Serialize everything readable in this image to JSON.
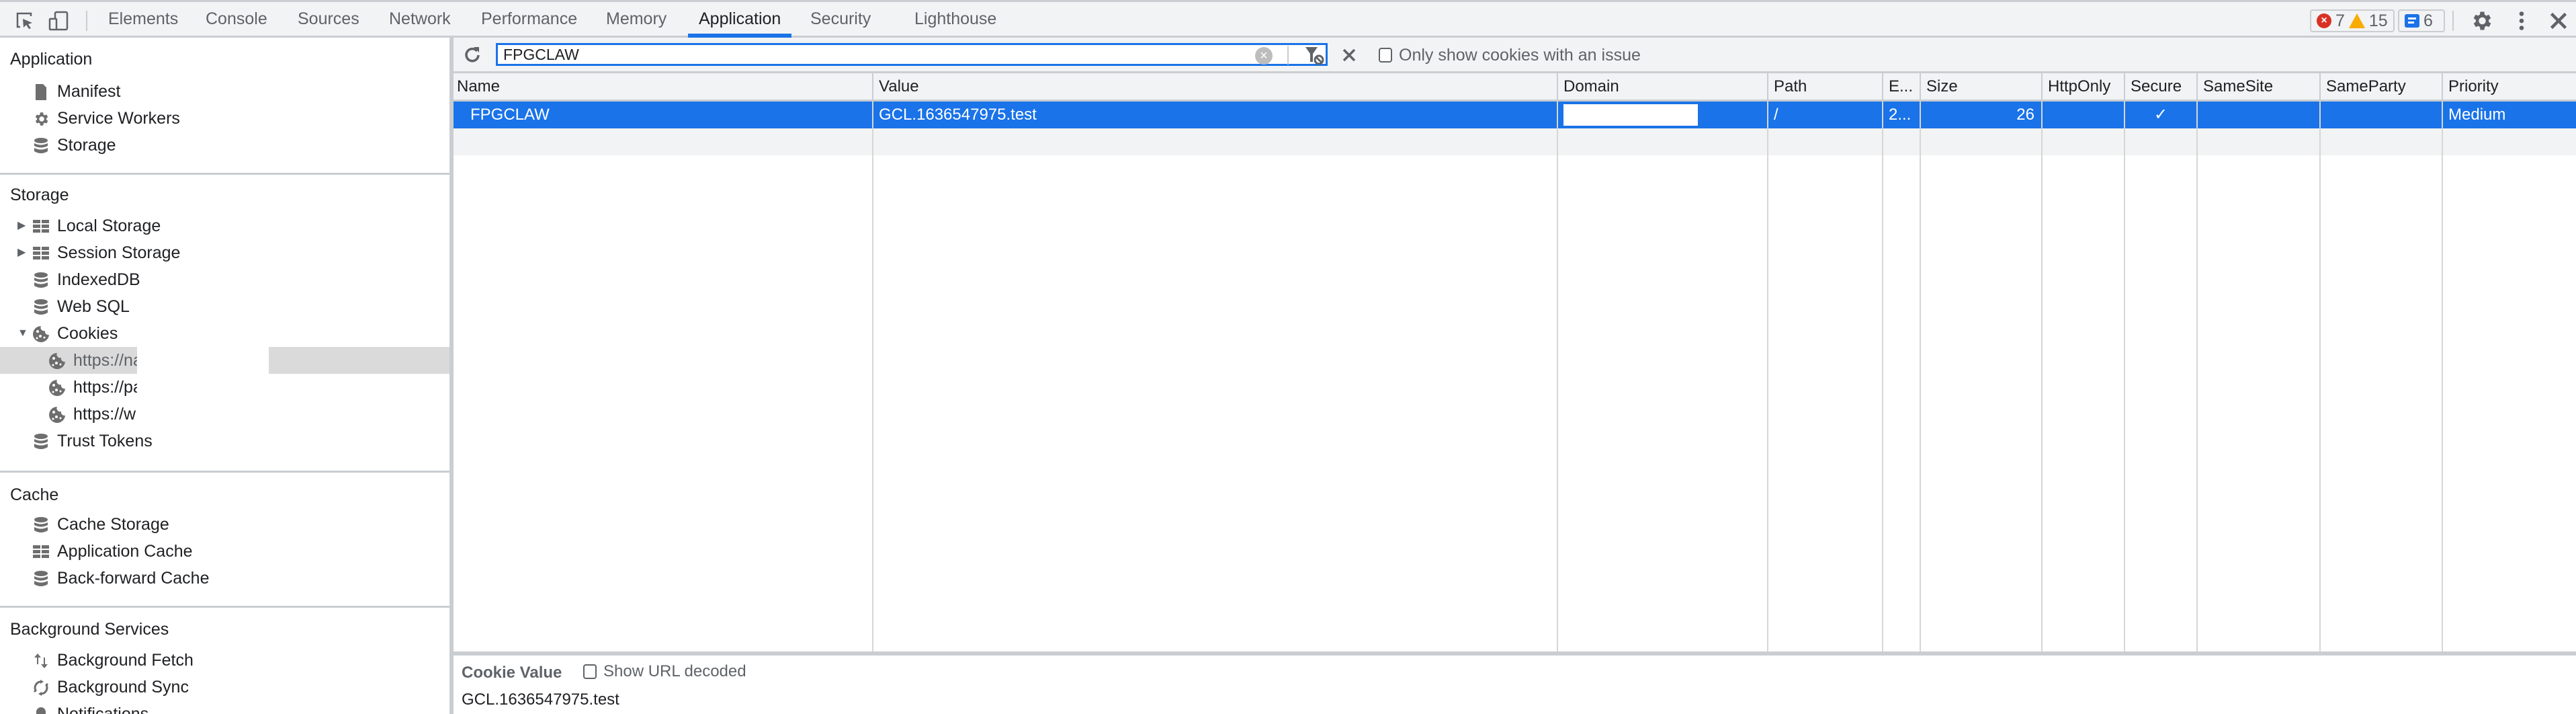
{
  "topbar": {
    "tabs": [
      {
        "label": "Elements",
        "active": false
      },
      {
        "label": "Console",
        "active": false
      },
      {
        "label": "Sources",
        "active": false
      },
      {
        "label": "Network",
        "active": false
      },
      {
        "label": "Performance",
        "active": false
      },
      {
        "label": "Memory",
        "active": false
      },
      {
        "label": "Application",
        "active": true
      },
      {
        "label": "Security",
        "active": false
      },
      {
        "label": "Lighthouse",
        "active": false
      }
    ],
    "errors_count": "7",
    "warnings_count": "15",
    "messages_count": "6",
    "accent_color": "#1a73e8"
  },
  "sidebar": {
    "sections": [
      {
        "title": "Application",
        "items": [
          {
            "label": "Manifest",
            "icon": "document-icon"
          },
          {
            "label": "Service Workers",
            "icon": "gear-icon"
          },
          {
            "label": "Storage",
            "icon": "database-icon"
          }
        ]
      },
      {
        "title": "Storage",
        "items": [
          {
            "label": "Local Storage",
            "icon": "grid-icon",
            "expandable": true,
            "expanded": false
          },
          {
            "label": "Session Storage",
            "icon": "grid-icon",
            "expandable": true,
            "expanded": false
          },
          {
            "label": "IndexedDB",
            "icon": "database-icon"
          },
          {
            "label": "Web SQL",
            "icon": "database-icon"
          },
          {
            "label": "Cookies",
            "icon": "cookie-icon",
            "expandable": true,
            "expanded": true,
            "children": [
              {
                "label": "https://na",
                "icon": "cookie-icon",
                "selected": true
              },
              {
                "label": "https://pa",
                "icon": "cookie-icon"
              },
              {
                "label": "https://w",
                "icon": "cookie-icon"
              }
            ]
          },
          {
            "label": "Trust Tokens",
            "icon": "database-icon"
          }
        ]
      },
      {
        "title": "Cache",
        "items": [
          {
            "label": "Cache Storage",
            "icon": "database-icon"
          },
          {
            "label": "Application Cache",
            "icon": "grid-icon"
          },
          {
            "label": "Back-forward Cache",
            "icon": "database-icon"
          }
        ]
      },
      {
        "title": "Background Services",
        "items": [
          {
            "label": "Background Fetch",
            "icon": "arrows-updown-icon"
          },
          {
            "label": "Background Sync",
            "icon": "sync-icon"
          },
          {
            "label": "Notifications",
            "icon": "bell-icon"
          }
        ]
      }
    ]
  },
  "toolbar": {
    "filter_value": "FPGCLAW",
    "only_issues_label": "Only show cookies with an issue",
    "only_issues_checked": false
  },
  "table": {
    "columns": [
      "Name",
      "Value",
      "Domain",
      "Path",
      "E...",
      "Size",
      "HttpOnly",
      "Secure",
      "SameSite",
      "SameParty",
      "Priority"
    ],
    "rows": [
      {
        "selected": true,
        "cells": [
          "FPGCLAW",
          "GCL.1636547975.test",
          "",
          "/",
          "2...",
          "26",
          "",
          "✓",
          "",
          "",
          "Medium"
        ]
      }
    ]
  },
  "detail": {
    "title": "Cookie Value",
    "url_decoded_label": "Show URL decoded",
    "url_decoded_checked": false,
    "value": "GCL.1636547975.test"
  }
}
